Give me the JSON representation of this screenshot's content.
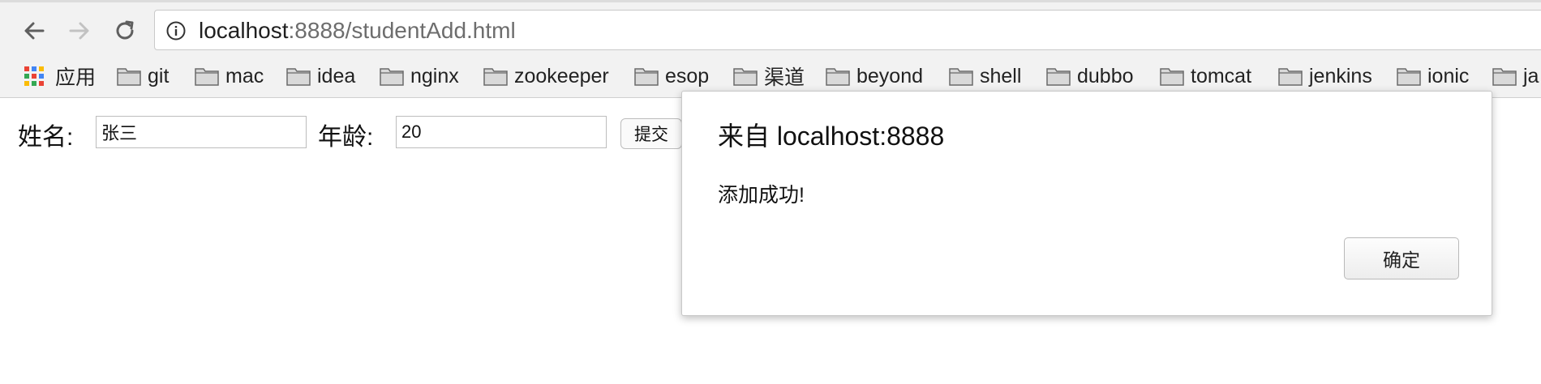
{
  "browser": {
    "url_host": "localhost",
    "url_rest": ":8888/studentAdd.html",
    "bookmarks": [
      {
        "label": "应用",
        "icon": "apps-grid-icon"
      },
      {
        "label": "git",
        "icon": "folder-icon"
      },
      {
        "label": "mac",
        "icon": "folder-icon"
      },
      {
        "label": "idea",
        "icon": "folder-icon"
      },
      {
        "label": "nginx",
        "icon": "folder-icon"
      },
      {
        "label": "zookeeper",
        "icon": "folder-icon"
      },
      {
        "label": "esop",
        "icon": "folder-icon"
      },
      {
        "label": "渠道",
        "icon": "folder-icon"
      },
      {
        "label": "beyond",
        "icon": "folder-icon"
      },
      {
        "label": "shell",
        "icon": "folder-icon"
      },
      {
        "label": "dubbo",
        "icon": "folder-icon"
      },
      {
        "label": "tomcat",
        "icon": "folder-icon"
      },
      {
        "label": "jenkins",
        "icon": "folder-icon"
      },
      {
        "label": "ionic",
        "icon": "folder-icon"
      },
      {
        "label": "ja",
        "icon": "folder-icon"
      }
    ]
  },
  "form": {
    "name_label": "姓名:",
    "name_value": "张三",
    "age_label": "年龄:",
    "age_value": "20",
    "submit_label": "提交"
  },
  "dialog": {
    "title": "来自 localhost:8888",
    "message": "添加成功!",
    "ok_label": "确定"
  }
}
